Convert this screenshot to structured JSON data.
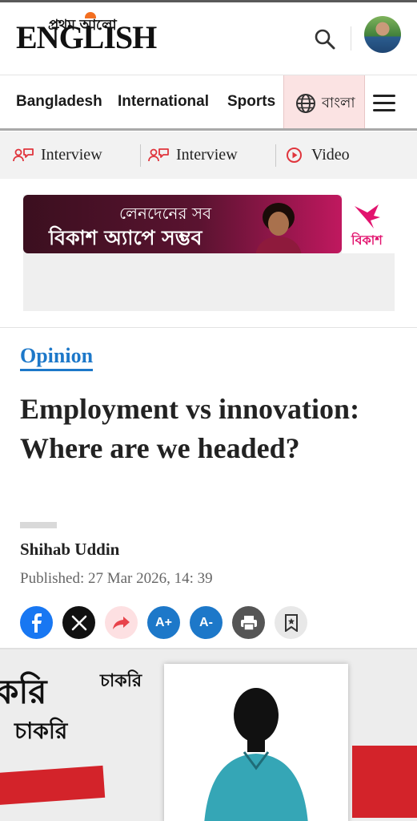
{
  "header": {
    "logo_bangla": "প্রথম আলো",
    "logo_english": "ENGLISH"
  },
  "nav": {
    "items": [
      "Bangladesh",
      "International",
      "Sports"
    ],
    "language_label": "বাংলা"
  },
  "subnav": {
    "items": [
      {
        "label": "Interview",
        "icon": "interview-icon"
      },
      {
        "label": "Interview",
        "icon": "interview-icon"
      },
      {
        "label": "Video",
        "icon": "video-play-icon"
      }
    ]
  },
  "ad": {
    "line1": "লেনদেনের সব",
    "line2": "বিকাশ অ্যাপে সম্ভব",
    "brand": "বিকাশ"
  },
  "article": {
    "category": "Opinion",
    "headline": "Employment vs innovation: Where are we headed?",
    "author": "Shihab Uddin",
    "published": "Published: 27 Mar 2026, 14: 39"
  },
  "share": {
    "buttons": [
      "facebook-icon",
      "x-icon",
      "share-icon",
      "font-increase-icon",
      "font-decrease-icon",
      "print-icon",
      "bookmark-icon"
    ],
    "font_increase_label": "A+",
    "font_decrease_label": "A-"
  },
  "hero": {
    "text1": "করি",
    "text2": "চাকরি",
    "text3": "চাকরি"
  },
  "colors": {
    "accent_blue": "#1d78c9",
    "facebook": "#1877f2",
    "share_red": "#e8434b",
    "bkash_pink": "#e2136e"
  }
}
